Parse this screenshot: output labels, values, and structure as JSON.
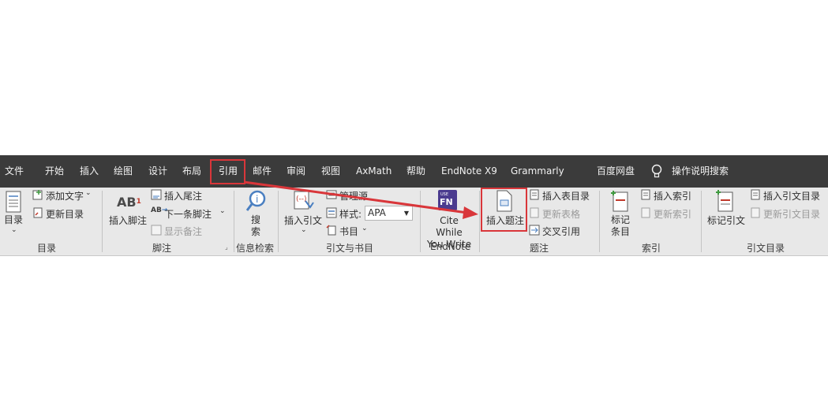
{
  "tabs": [
    "文件",
    "开始",
    "插入",
    "绘图",
    "设计",
    "布局",
    "引用",
    "邮件",
    "审阅",
    "视图",
    "AxMath",
    "帮助",
    "EndNote X9",
    "Grammarly",
    "百度网盘",
    "操作说明搜索"
  ],
  "toc": {
    "big": "目录",
    "add_text": "添加文字",
    "update": "更新目录",
    "group": "目录"
  },
  "footnotes": {
    "insert_footnote": "插入脚注",
    "insert_endnote": "插入尾注",
    "next_footnote": "下一条脚注",
    "show_notes": "显示备注",
    "group": "脚注"
  },
  "research": {
    "search": "搜索",
    "group": "信息检索"
  },
  "citations": {
    "insert_citation": "插入引文",
    "manage_sources": "管理源",
    "style_label": "样式:",
    "style_value": "APA",
    "bibliography": "书目",
    "group": "引文与书目"
  },
  "endnote": {
    "cite_while_you_write": "Cite While You Write",
    "group": "EndNote"
  },
  "captions": {
    "insert_caption": "插入题注",
    "insert_table_of_figures": "插入表目录",
    "update_table": "更新表格",
    "cross_reference": "交叉引用",
    "group": "题注"
  },
  "index": {
    "mark_entry": "标记条目",
    "insert_index": "插入索引",
    "update_index": "更新索引",
    "group": "索引"
  },
  "toa": {
    "mark_citation": "标记引文",
    "insert_toa": "插入引文目录",
    "update_toa": "更新引文目录",
    "group": "引文目录"
  },
  "colors": {
    "highlight": "#d9363a",
    "tabbar": "#3b3b3b",
    "ribbon": "#e8e8e8"
  }
}
